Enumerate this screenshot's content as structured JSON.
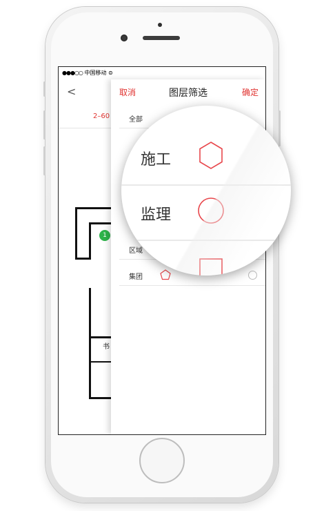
{
  "status_bar": {
    "signal": "●●●○○",
    "carrier": "中国移动",
    "wifi": "⊜"
  },
  "background_page": {
    "back": "<",
    "subtitle": "2–60",
    "room_label_1": "书",
    "room_label_2": "",
    "pin_number": "1"
  },
  "filter_panel": {
    "cancel": "取消",
    "title": "图层筛选",
    "confirm": "确定",
    "rows": [
      {
        "label": "全部"
      },
      {
        "label": "区域"
      },
      {
        "label": "集团",
        "icon": "pentagon-icon"
      }
    ]
  },
  "magnifier": {
    "rows": [
      {
        "label": "施工",
        "icon": "hexagon-icon"
      },
      {
        "label": "监理",
        "icon": "circle-icon"
      },
      {
        "label": "",
        "icon": "square-icon"
      }
    ]
  },
  "colors": {
    "accent": "#e0322f",
    "shape_stroke": "#e8464b",
    "pin": "#2db34a"
  }
}
